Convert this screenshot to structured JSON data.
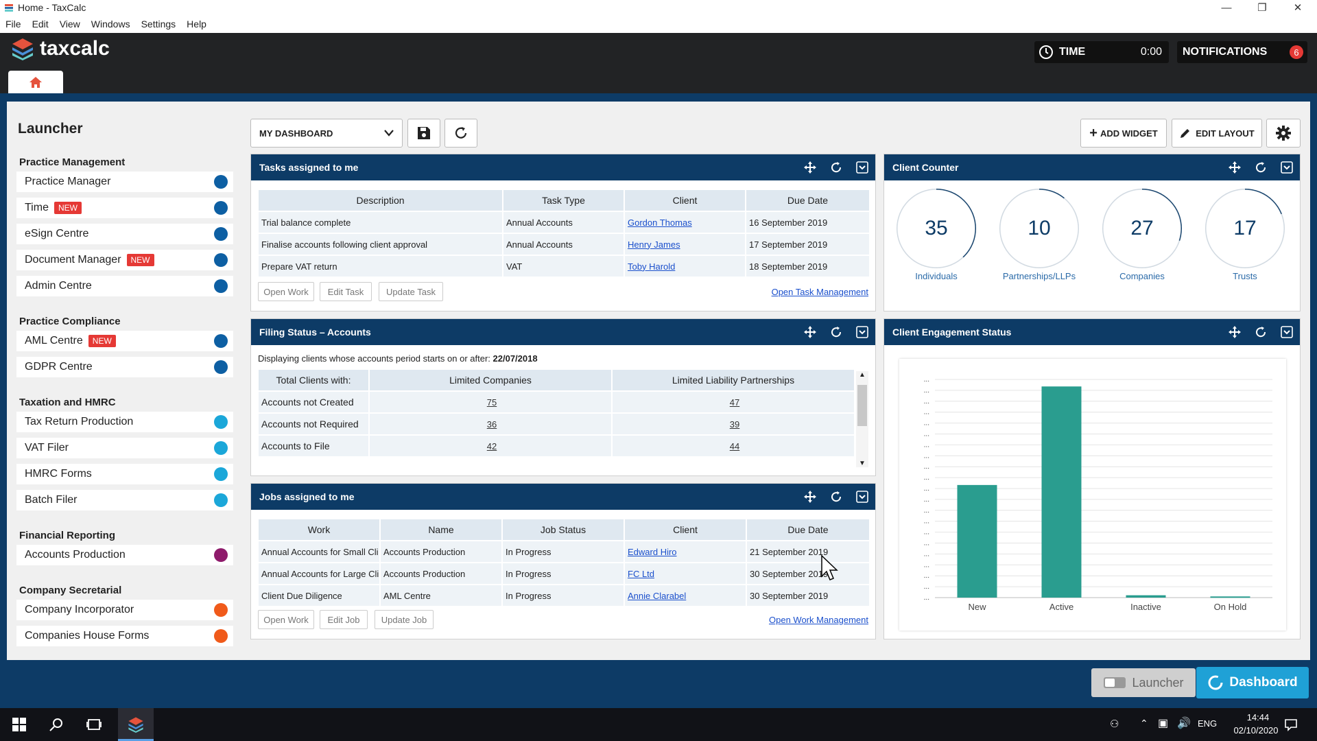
{
  "window": {
    "title": "Home - TaxCalc"
  },
  "menu": [
    "File",
    "Edit",
    "View",
    "Windows",
    "Settings",
    "Help"
  ],
  "header": {
    "logo_text": "taxcalc",
    "time_label": "TIME",
    "time_value": "0:00",
    "notifications_label": "NOTIFICATIONS",
    "notifications_count": "6"
  },
  "launcher": {
    "title": "Launcher",
    "sections": [
      {
        "name": "Practice Management",
        "items": [
          {
            "label": "Practice Manager",
            "new": false,
            "color": "#0d5fa3"
          },
          {
            "label": "Time",
            "new": true,
            "color": "#0d5fa3"
          },
          {
            "label": "eSign Centre",
            "new": false,
            "color": "#0d5fa3"
          },
          {
            "label": "Document Manager",
            "new": true,
            "color": "#0d5fa3"
          },
          {
            "label": "Admin Centre",
            "new": false,
            "color": "#0d5fa3"
          }
        ]
      },
      {
        "name": "Practice Compliance",
        "items": [
          {
            "label": "AML Centre",
            "new": true,
            "color": "#0d5fa3"
          },
          {
            "label": "GDPR Centre",
            "new": false,
            "color": "#0d5fa3"
          }
        ]
      },
      {
        "name": "Taxation and HMRC",
        "items": [
          {
            "label": "Tax Return Production",
            "new": false,
            "color": "#1ba7d9"
          },
          {
            "label": "VAT Filer",
            "new": false,
            "color": "#1ba7d9"
          },
          {
            "label": "HMRC Forms",
            "new": false,
            "color": "#1ba7d9"
          },
          {
            "label": "Batch Filer",
            "new": false,
            "color": "#1ba7d9"
          }
        ]
      },
      {
        "name": "Financial Reporting",
        "items": [
          {
            "label": "Accounts Production",
            "new": false,
            "color": "#8e1b6b"
          }
        ]
      },
      {
        "name": "Company Secretarial",
        "items": [
          {
            "label": "Company Incorporator",
            "new": false,
            "color": "#f05a1a"
          },
          {
            "label": "Companies House Forms",
            "new": false,
            "color": "#f05a1a"
          }
        ]
      }
    ],
    "new_badge": "NEW"
  },
  "toolbar": {
    "dashboard_select": "MY DASHBOARD",
    "add_widget": "ADD WIDGET",
    "edit_layout": "EDIT LAYOUT"
  },
  "tasks": {
    "title": "Tasks assigned to me",
    "headers": [
      "Description",
      "Task Type",
      "Client",
      "Due Date"
    ],
    "rows": [
      [
        "Trial balance complete",
        "Annual Accounts",
        "Gordon Thomas",
        "16 September 2019"
      ],
      [
        "Finalise accounts following client approval",
        "Annual Accounts",
        "Henry James",
        "17 September 2019"
      ],
      [
        "Prepare VAT return",
        "VAT",
        "Toby Harold",
        "18 September 2019"
      ]
    ],
    "buttons": [
      "Open Work",
      "Edit Task",
      "Update Task"
    ],
    "link": "Open Task Management"
  },
  "filing": {
    "title": "Filing Status – Accounts",
    "note": "Displaying clients whose accounts period starts on or after:",
    "note_date": "22/07/2018",
    "headers": [
      "Total Clients with:",
      "Limited Companies",
      "Limited Liability Partnerships"
    ],
    "rows": [
      [
        "Accounts not Created",
        "75",
        "47"
      ],
      [
        "Accounts not Required",
        "36",
        "39"
      ],
      [
        "Accounts to File",
        "42",
        "44"
      ]
    ]
  },
  "jobs": {
    "title": "Jobs assigned to me",
    "headers": [
      "Work",
      "Name",
      "Job Status",
      "Client",
      "Due Date"
    ],
    "rows": [
      [
        "Annual Accounts for Small Cli",
        "Accounts Production",
        "In Progress",
        "Edward Hiro",
        "21 September 2019"
      ],
      [
        "Annual Accounts for Large Cli",
        "Accounts Production",
        "In Progress",
        "FC Ltd",
        "30 September 2019"
      ],
      [
        "Client Due Diligence",
        "AML Centre",
        "In Progress",
        "Annie Clarabel",
        "30 September 2019"
      ]
    ],
    "buttons": [
      "Open Work",
      "Edit Job",
      "Update Job"
    ],
    "link": "Open Work Management"
  },
  "counter": {
    "title": "Client Counter",
    "items": [
      {
        "value": "35",
        "label": "Individuals"
      },
      {
        "value": "10",
        "label": "Partnerships/LLPs"
      },
      {
        "value": "27",
        "label": "Companies"
      },
      {
        "value": "17",
        "label": "Trusts"
      }
    ]
  },
  "engagement": {
    "title": "Client Engagement Status"
  },
  "chart_data": {
    "type": "bar",
    "categories": [
      "New",
      "Active",
      "Inactive",
      "On Hold"
    ],
    "values": [
      48,
      90,
      1,
      0.5
    ],
    "ylim": [
      0,
      93
    ],
    "color": "#2a9d8f",
    "ytick_labels_legible": false
  },
  "bottom": {
    "launcher": "Launcher",
    "dashboard": "Dashboard"
  },
  "taskbar": {
    "lang": "ENG",
    "time": "14:44",
    "date": "02/10/2020"
  }
}
